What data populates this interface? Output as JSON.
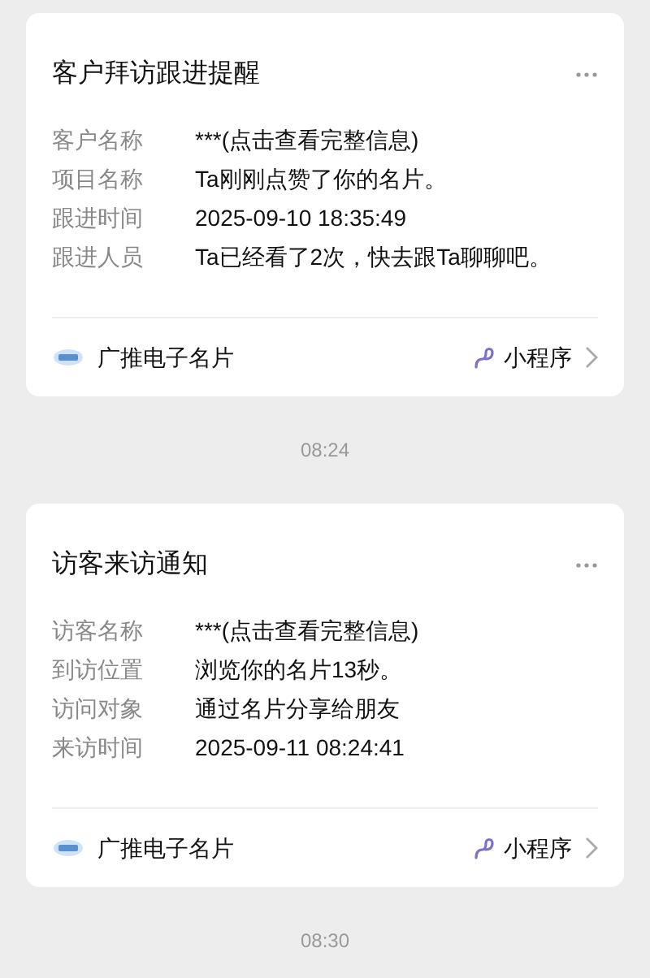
{
  "messages": [
    {
      "title": "客户拜访跟进提醒",
      "fields": [
        {
          "label": "客户名称",
          "value": "***(点击查看完整信息)"
        },
        {
          "label": "项目名称",
          "value": "Ta刚刚点赞了你的名片。"
        },
        {
          "label": "跟进时间",
          "value": "2025-09-10 18:35:49"
        },
        {
          "label": "跟进人员",
          "value": "Ta已经看了2次，快去跟Ta聊聊吧。"
        }
      ],
      "source": "广推电子名片",
      "mini_program": "小程序",
      "time": "08:24"
    },
    {
      "title": "访客来访通知",
      "fields": [
        {
          "label": "访客名称",
          "value": "***(点击查看完整信息)"
        },
        {
          "label": "到访位置",
          "value": "浏览你的名片13秒。"
        },
        {
          "label": "访问对象",
          "value": "通过名片分享给朋友"
        },
        {
          "label": "来访时间",
          "value": "2025-09-11 08:24:41"
        }
      ],
      "source": "广推电子名片",
      "mini_program": "小程序",
      "time": "08:30"
    }
  ]
}
